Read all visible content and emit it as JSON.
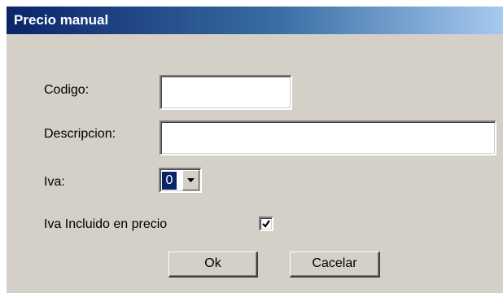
{
  "window": {
    "title": "Precio manual"
  },
  "form": {
    "codigo_label": "Codigo:",
    "codigo_value": "",
    "descripcion_label": "Descripcion:",
    "descripcion_value": "",
    "iva_label": "Iva:",
    "iva_selected": "0",
    "iva_incluido_label": "Iva Incluido en precio",
    "iva_incluido_checked": true
  },
  "buttons": {
    "ok_label": "Ok",
    "cancel_label": "Cacelar"
  },
  "icons": {
    "dropdown": "chevron-down-icon",
    "check": "checkmark-icon"
  },
  "colors": {
    "title_gradient_start": "#0a246a",
    "title_gradient_end": "#a6caf0",
    "dialog_background": "#d4d0c8",
    "selection": "#0a246a"
  }
}
